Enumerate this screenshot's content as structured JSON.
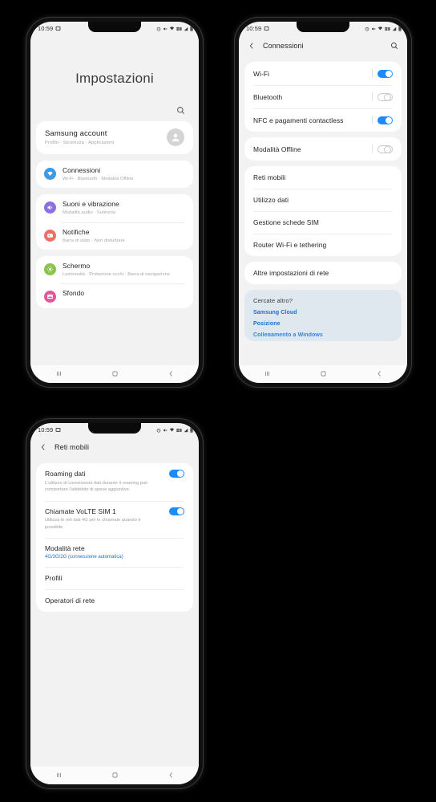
{
  "status_bar": {
    "time": "10:59",
    "left_icons": [
      "screenshot-icon"
    ],
    "right_icons": [
      "alarm-icon",
      "mute-icon",
      "wifi-icon",
      "data-icon",
      "signal-icon",
      "battery-icon"
    ]
  },
  "nav_bar": {
    "recents_label": "|||",
    "home_label": "",
    "back_label": "‹"
  },
  "phone1": {
    "title": "Impostazioni",
    "search_icon": "search-icon",
    "account": {
      "title": "Samsung account",
      "subtitle": "Profilo · Sicurezza · Applicazioni",
      "avatar_icon": "person-icon"
    },
    "groups": [
      {
        "items": [
          {
            "title": "Connessioni",
            "subtitle": "Wi-Fi · Bluetooth · Modalità Offline",
            "icon": "wifi-icon",
            "color": "#3d9ae4"
          }
        ]
      },
      {
        "items": [
          {
            "title": "Suoni e vibrazione",
            "subtitle": "Modalità audio · Suoneria",
            "icon": "volume-icon",
            "color": "#8c71dd"
          },
          {
            "title": "Notifiche",
            "subtitle": "Barra di stato · Non disturbare",
            "icon": "notification-icon",
            "color": "#ef7062"
          }
        ]
      },
      {
        "items": [
          {
            "title": "Schermo",
            "subtitle": "Luminosità · Protezione occhi · Barra di navigazione",
            "icon": "brightness-icon",
            "color": "#8ac349"
          },
          {
            "title": "Sfondo",
            "subtitle": "",
            "icon": "wallpaper-icon",
            "color": "#e8529b"
          }
        ]
      }
    ]
  },
  "phone2": {
    "back_icon": "back-chevron-icon",
    "title": "Connessioni",
    "search_icon": "search-icon",
    "toggle_group_1": [
      {
        "label": "Wi-Fi",
        "state": "on"
      },
      {
        "label": "Bluetooth",
        "state": "off"
      },
      {
        "label": "NFC e pagamenti contactless",
        "state": "on"
      }
    ],
    "toggle_group_2": [
      {
        "label": "Modalità Offline",
        "state": "off"
      }
    ],
    "link_group_1": [
      {
        "label": "Reti mobili"
      },
      {
        "label": "Utilizzo dati"
      },
      {
        "label": "Gestione schede SIM"
      },
      {
        "label": "Router Wi-Fi e tethering"
      }
    ],
    "link_group_2": [
      {
        "label": "Altre impostazioni di rete"
      }
    ],
    "more_section": {
      "heading": "Cercate altro?",
      "links": [
        "Samsung Cloud",
        "Posizione",
        "Collegamento a Windows"
      ]
    }
  },
  "phone3": {
    "back_icon": "back-chevron-icon",
    "title": "Reti mobili",
    "items": [
      {
        "title": "Roaming dati",
        "subtitle": "L'utilizzo di connessioni dati durante il roaming può comportare l'addebito di spese aggiuntive.",
        "toggle": "on"
      },
      {
        "title": "Chiamate VoLTE SIM 1",
        "subtitle": "Utilizza le reti dati 4G per le chiamate quando è possibile.",
        "toggle": "on"
      },
      {
        "title": "Modalità rete",
        "value": "4G/3G/2G (connessione automatica)"
      },
      {
        "title": "Profili"
      },
      {
        "title": "Operatori di rete"
      }
    ]
  },
  "colors": {
    "accent_blue": "#1a8cff",
    "link_blue": "#1a6fd4",
    "screen_bg": "#f2f2f2",
    "card_bg": "#ffffff",
    "more_bg": "#dfe7ef"
  }
}
